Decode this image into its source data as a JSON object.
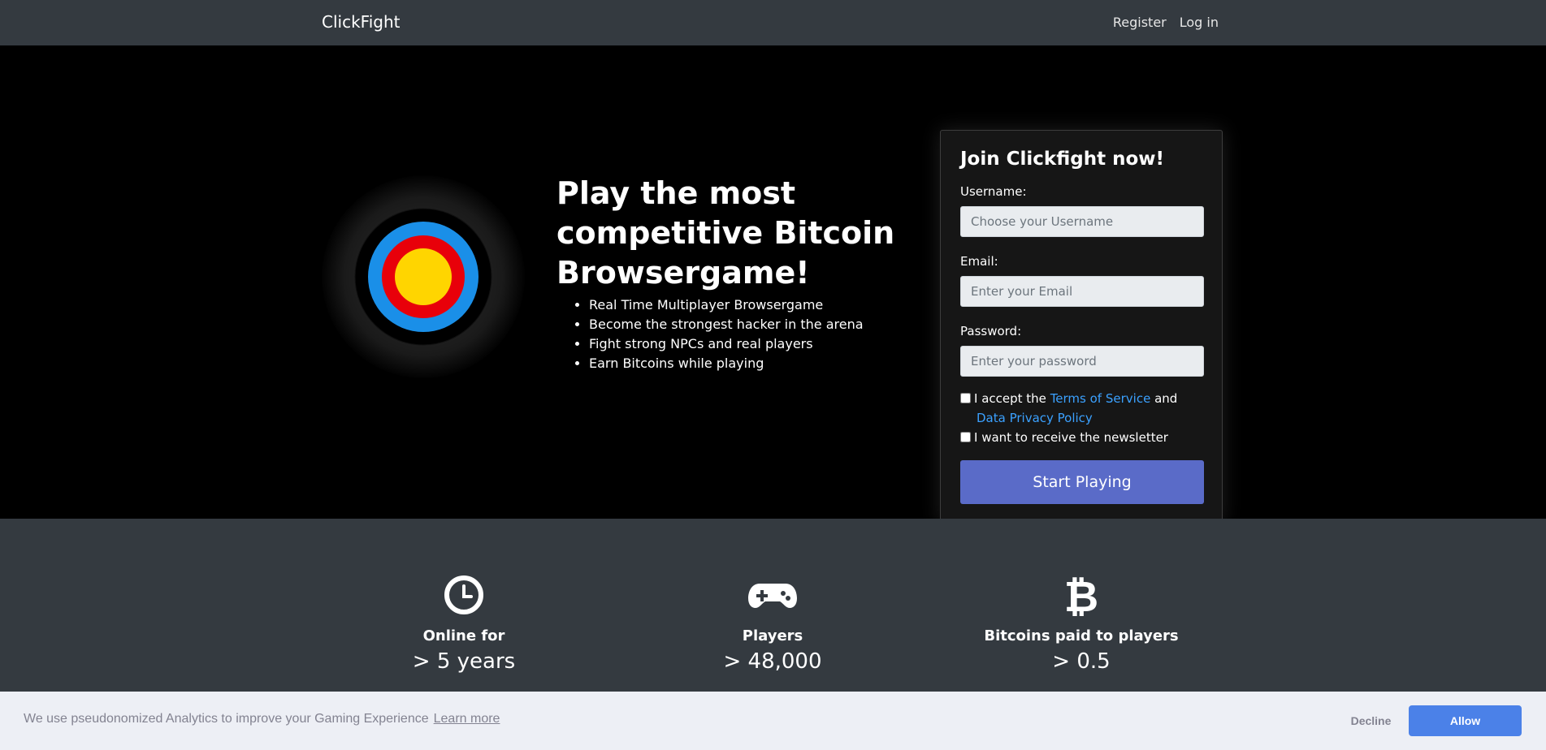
{
  "navbar": {
    "brand": "ClickFight",
    "links": {
      "register": "Register",
      "login": "Log in"
    }
  },
  "hero": {
    "title": "Play the most competitive Bitcoin Browsergame!",
    "features": [
      "Real Time Multiplayer Browsergame",
      "Become the strongest hacker in the arena",
      "Fight strong NPCs and real players",
      "Earn Bitcoins while playing"
    ],
    "target_colors": {
      "outer": "#000000",
      "ring1": "#1a8fe8",
      "ring2": "#e8000a",
      "center": "#ffd500"
    }
  },
  "register_form": {
    "title": "Join Clickfight now!",
    "username_label": "Username:",
    "username_placeholder": "Choose your Username",
    "email_label": "Email:",
    "email_placeholder": "Enter your Email",
    "password_label": "Password:",
    "password_placeholder": "Enter your password",
    "terms_prefix": "I accept the",
    "terms_link": "Terms of Service",
    "terms_and": "and",
    "privacy_link": "Data Privacy Policy",
    "newsletter_label": "I want to receive the newsletter",
    "submit_label": "Start Playing"
  },
  "stats": [
    {
      "icon": "clock-icon",
      "label": "Online for",
      "value": "> 5 years"
    },
    {
      "icon": "gamepad-icon",
      "label": "Players",
      "value": "> 48,000"
    },
    {
      "icon": "bitcoin-icon",
      "label": "Bitcoins paid to players",
      "value": "> 0.5"
    }
  ],
  "cookie_banner": {
    "text": "We use pseudonomized Analytics to improve your Gaming Experience",
    "learn_more": "Learn more",
    "decline": "Decline",
    "allow": "Allow"
  }
}
